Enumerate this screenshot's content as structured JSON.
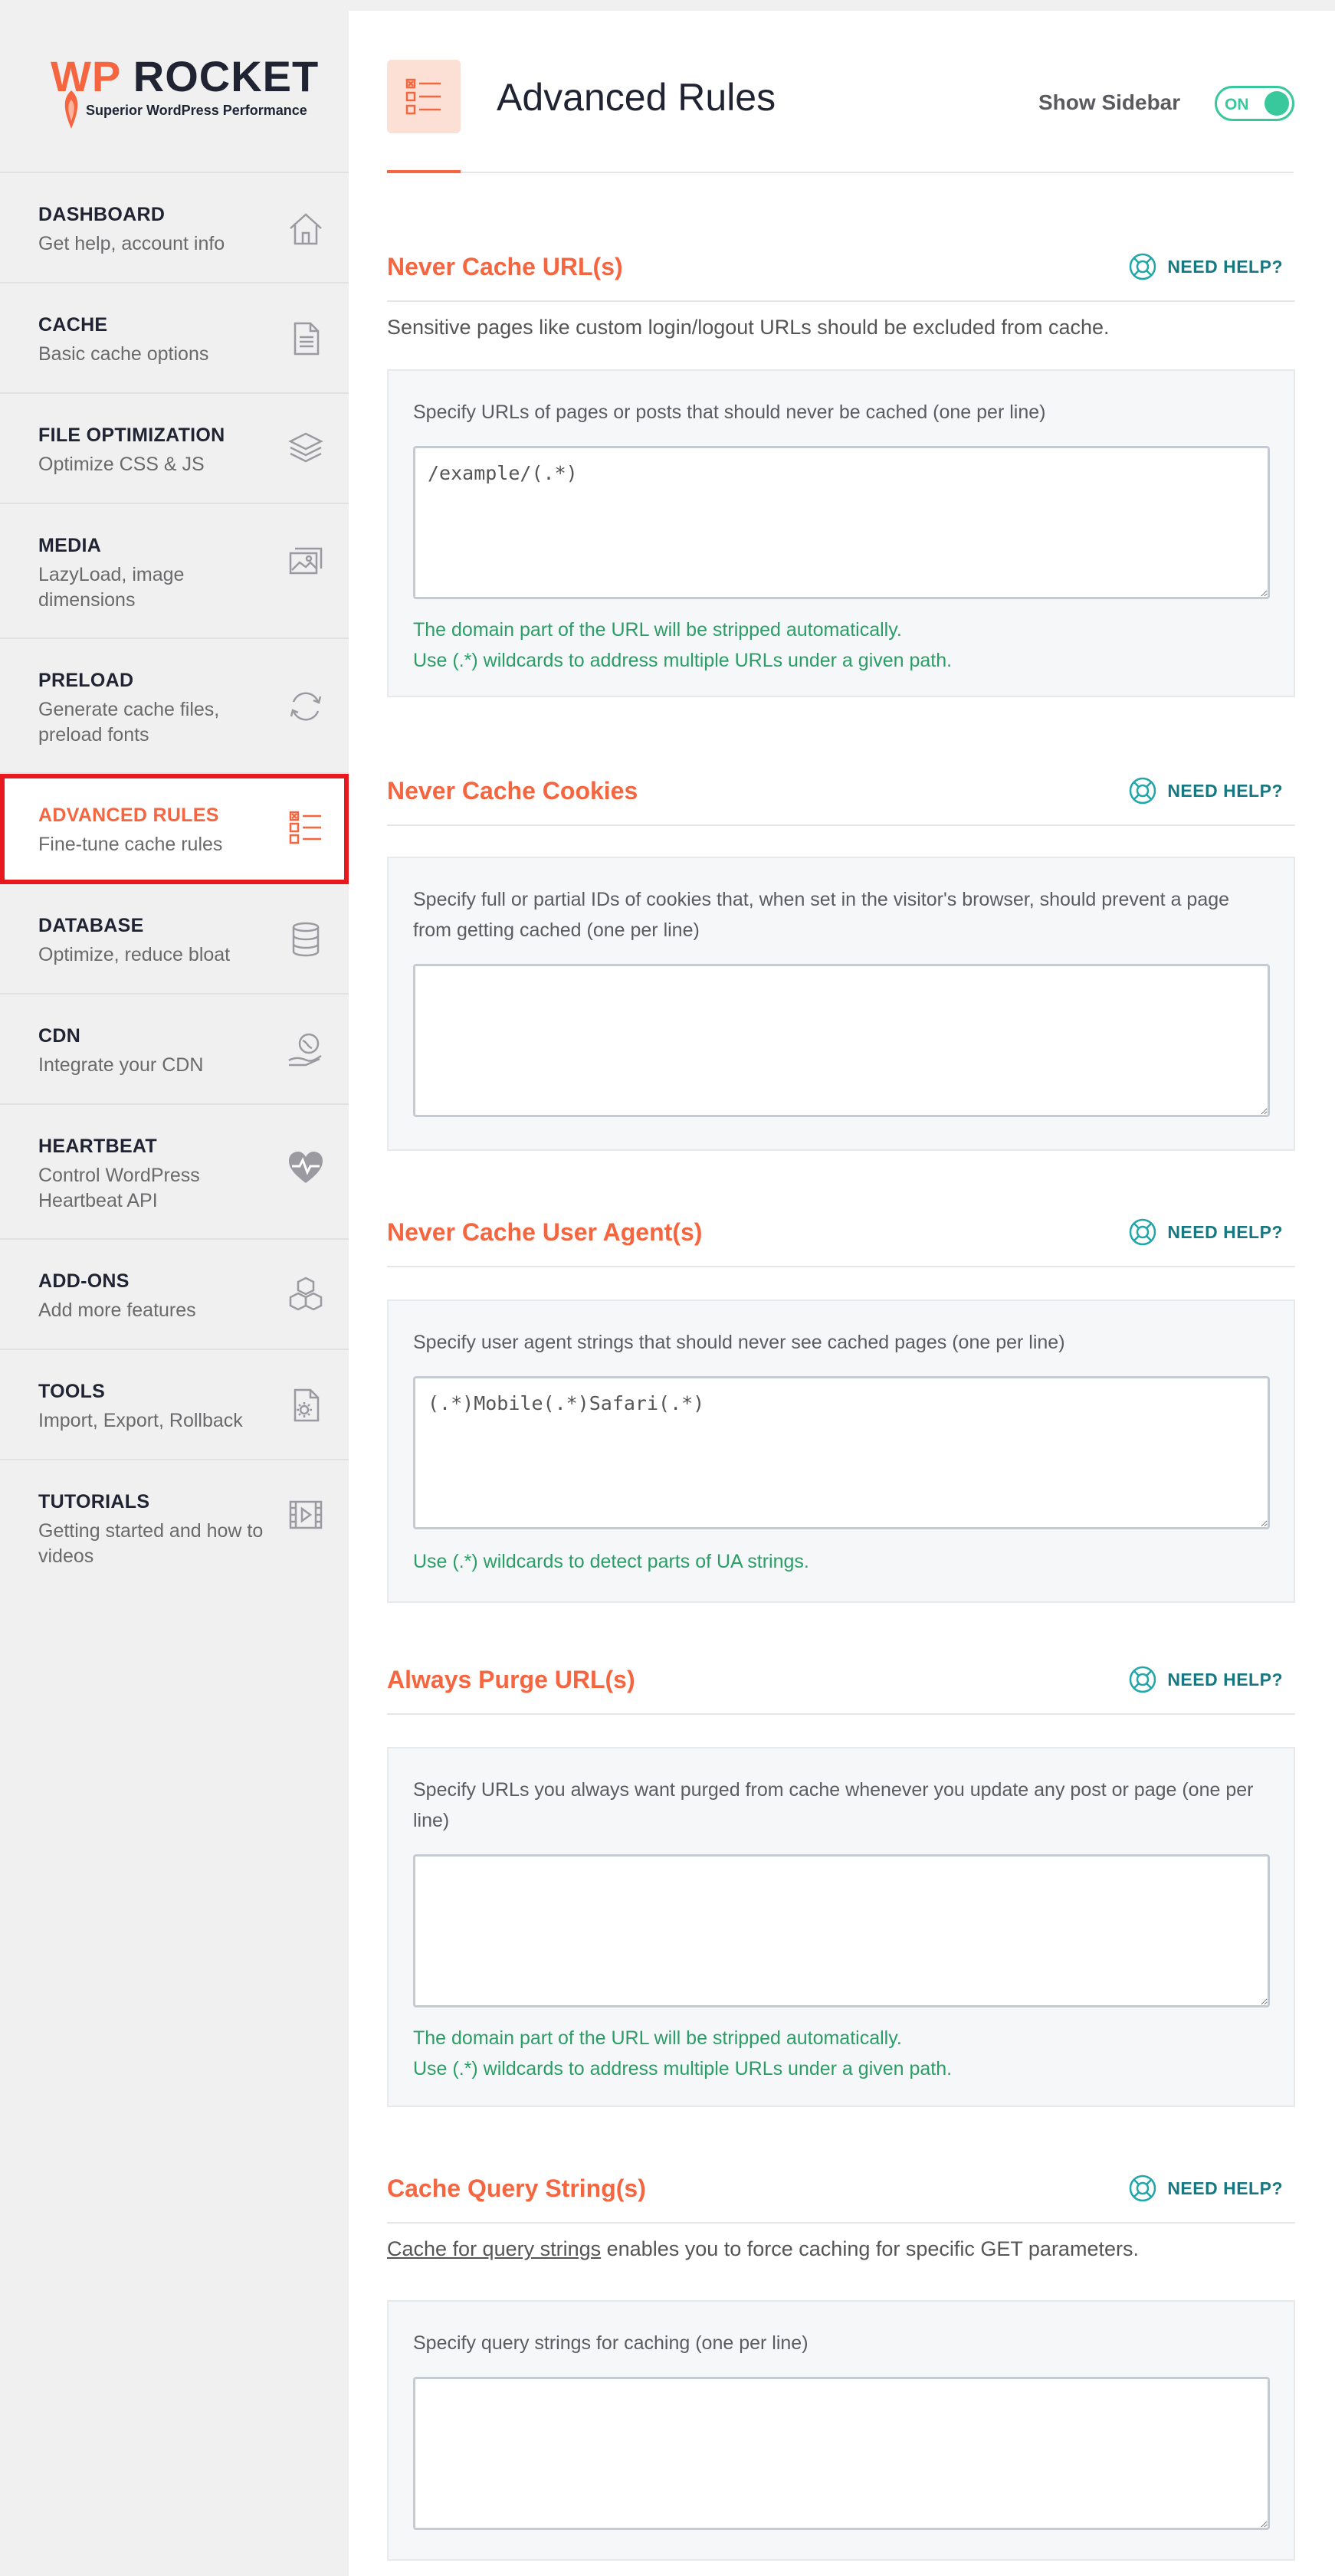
{
  "brand": {
    "logo_wp": "WP",
    "logo_rocket": "ROCKET",
    "tagline": "Superior WordPress Performance",
    "accent": "#f56640",
    "dark": "#1f2332",
    "teal": "#167982",
    "green": "#38c89b"
  },
  "sidebar": {
    "items": [
      {
        "title": "DASHBOARD",
        "desc": "Get help, account info",
        "icon": "house-icon"
      },
      {
        "title": "CACHE",
        "desc": "Basic cache options",
        "icon": "file-icon"
      },
      {
        "title": "FILE OPTIMIZATION",
        "desc": "Optimize CSS & JS",
        "icon": "layers-icon"
      },
      {
        "title": "MEDIA",
        "desc": "LazyLoad, image dimensions",
        "icon": "images-icon"
      },
      {
        "title": "PRELOAD",
        "desc": "Generate cache files, preload fonts",
        "icon": "refresh-icon"
      },
      {
        "title": "ADVANCED RULES",
        "desc": "Fine-tune cache rules",
        "icon": "checklist-icon",
        "active": true
      },
      {
        "title": "DATABASE",
        "desc": "Optimize, reduce bloat",
        "icon": "database-icon"
      },
      {
        "title": "CDN",
        "desc": "Integrate your CDN",
        "icon": "globe-hand-icon"
      },
      {
        "title": "HEARTBEAT",
        "desc": "Control WordPress Heartbeat API",
        "icon": "heartbeat-icon"
      },
      {
        "title": "ADD-ONS",
        "desc": "Add more features",
        "icon": "cubes-icon"
      },
      {
        "title": "TOOLS",
        "desc": "Import, Export, Rollback",
        "icon": "gear-file-icon"
      },
      {
        "title": "TUTORIALS",
        "desc": "Getting started and how to videos",
        "icon": "video-icon"
      }
    ]
  },
  "header": {
    "title": "Advanced Rules",
    "show_sidebar_label": "Show Sidebar",
    "toggle_state": "ON"
  },
  "help_label": "NEED HELP?",
  "sections": [
    {
      "title": "Never Cache URL(s)",
      "desc": "Sensitive pages like custom login/logout URLs should be excluded from cache.",
      "label": "Specify URLs of pages or posts that should never be cached (one per line)",
      "value": "/example/(.*)",
      "notes": [
        "The domain part of the URL will be stripped automatically.",
        "Use (.*) wildcards to address multiple URLs under a given path."
      ]
    },
    {
      "title": "Never Cache Cookies",
      "label": "Specify full or partial IDs of cookies that, when set in the visitor's browser, should prevent a page from getting cached (one per line)",
      "value": ""
    },
    {
      "title": "Never Cache User Agent(s)",
      "label": "Specify user agent strings that should never see cached pages (one per line)",
      "value": "(.*)Mobile(.*)Safari(.*)",
      "notes": [
        "Use (.*) wildcards to detect parts of UA strings."
      ]
    },
    {
      "title": "Always Purge URL(s)",
      "label": "Specify URLs you always want purged from cache whenever you update any post or page (one per line)",
      "value": "",
      "notes": [
        "The domain part of the URL will be stripped automatically.",
        "Use (.*) wildcards to address multiple URLs under a given path."
      ]
    },
    {
      "title": "Cache Query String(s)",
      "desc_link": "Cache for query strings",
      "desc_rest": " enables you to force caching for specific GET parameters.",
      "label": "Specify query strings for caching (one per line)",
      "value": ""
    }
  ]
}
